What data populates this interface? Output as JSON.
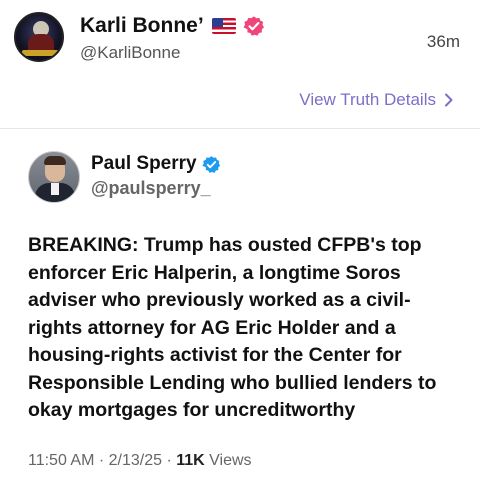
{
  "post": {
    "author_name": "Karli Bonne’",
    "author_handle": "@KarliBonne",
    "timestamp": "36m",
    "flag_icon": "us-flag-icon",
    "verified_color": "#f0457a"
  },
  "actions": {
    "view_details_label": "View Truth Details",
    "accent_color": "#7b6fc6"
  },
  "quoted": {
    "author_name": "Paul Sperry",
    "author_handle": "@paulsperry_",
    "verified_color": "#1d9bf0",
    "body": "BREAKING: Trump has ousted CFPB's top enforcer Eric Halperin, a longtime Soros adviser who previously worked as a civil-rights attorney for AG Eric Holder and a housing-rights activist for the Center for Responsible Lending who bullied lenders to okay mortgages for uncreditworthy",
    "meta_time_date": "11:50 AM · 2/13/25 · ",
    "meta_views": "11K",
    "meta_views_label": " Views"
  }
}
